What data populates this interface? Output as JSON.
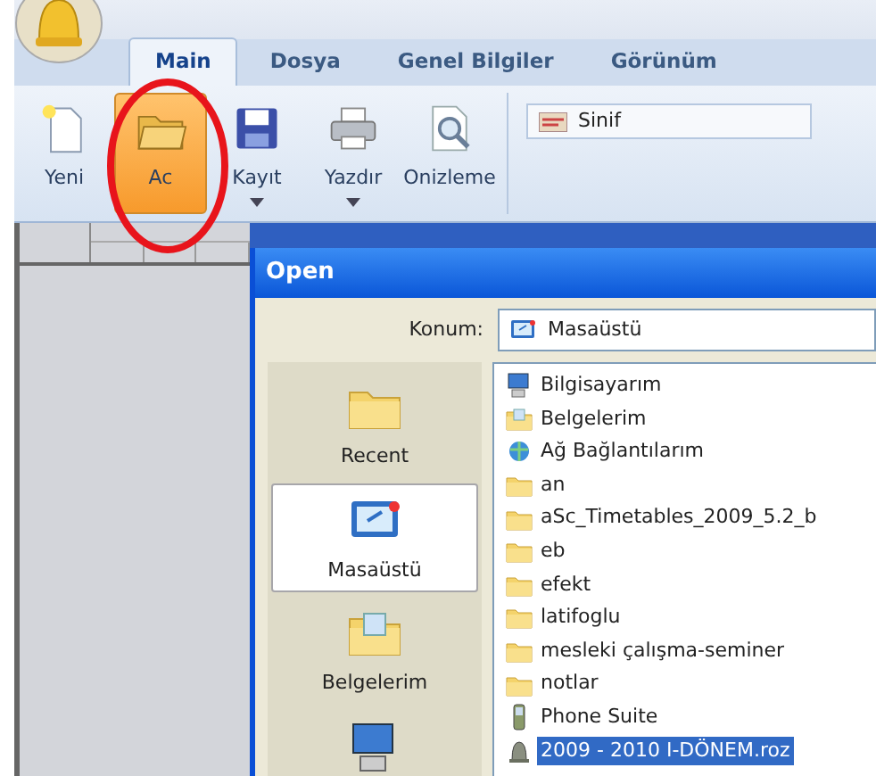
{
  "tabs": [
    {
      "label": "Main",
      "selected": true
    },
    {
      "label": "Dosya",
      "selected": false
    },
    {
      "label": "Genel Bilgiler",
      "selected": false
    },
    {
      "label": "Görünüm",
      "selected": false
    }
  ],
  "ribbon": {
    "buttons": [
      {
        "kind": "new",
        "label": "Yeni",
        "highlighted": false,
        "dropdown": false
      },
      {
        "kind": "open",
        "label": "Ac",
        "highlighted": true,
        "dropdown": false
      },
      {
        "kind": "save",
        "label": "Kayıt",
        "highlighted": false,
        "dropdown": true
      },
      {
        "kind": "print",
        "label": "Yazdır",
        "highlighted": false,
        "dropdown": true
      },
      {
        "kind": "preview",
        "label": "Onizleme",
        "highlighted": false,
        "dropdown": false
      }
    ],
    "class_field": {
      "value": "Sinif"
    }
  },
  "dialog": {
    "title": "Open",
    "location_label": "Konum:",
    "location_value": "Masaüstü",
    "places": [
      {
        "kind": "recent",
        "label": "Recent",
        "selected": false
      },
      {
        "kind": "desktop",
        "label": "Masaüstü",
        "selected": true
      },
      {
        "kind": "documents",
        "label": "Belgelerim",
        "selected": false
      },
      {
        "kind": "computer",
        "selected": false
      }
    ],
    "files": [
      {
        "kind": "computer",
        "name": "Bilgisayarım",
        "selected": false
      },
      {
        "kind": "documents",
        "name": "Belgelerim",
        "selected": false
      },
      {
        "kind": "network",
        "name": "Ağ Bağlantılarım",
        "selected": false
      },
      {
        "kind": "folder",
        "name": "an",
        "selected": false
      },
      {
        "kind": "folder",
        "name": "aSc_Timetables_2009_5.2_b",
        "selected": false
      },
      {
        "kind": "folder",
        "name": "eb",
        "selected": false
      },
      {
        "kind": "folder",
        "name": "efekt",
        "selected": false
      },
      {
        "kind": "folder",
        "name": "latifoglu",
        "selected": false
      },
      {
        "kind": "folder",
        "name": "mesleki çalışma-seminer",
        "selected": false
      },
      {
        "kind": "folder",
        "name": "notlar",
        "selected": false
      },
      {
        "kind": "phone",
        "name": "Phone Suite",
        "selected": false
      },
      {
        "kind": "roz",
        "name": "2009 - 2010 I-DÖNEM.roz",
        "selected": true
      }
    ]
  }
}
